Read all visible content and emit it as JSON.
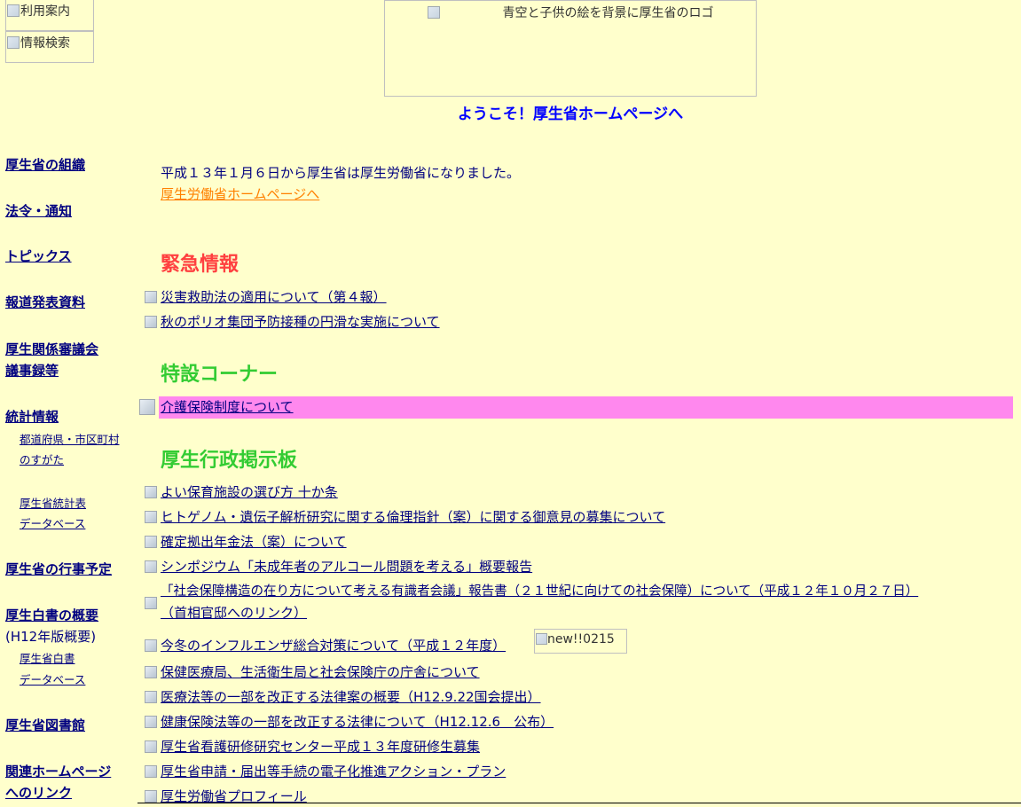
{
  "header": {
    "util_guide_alt": "利用案内",
    "info_search_alt": "情報検索",
    "logo_alt": "青空と子供の絵を背景に厚生省のロゴ",
    "welcome": "ようこそ！厚生省ホームページへ"
  },
  "sidebar": {
    "organization": "厚生省の組織",
    "laws": "法令・通知",
    "topics": "トピックス",
    "press": "報道発表資料",
    "council_line1": "厚生関係審議会",
    "council_line2": "議事録等",
    "statistics": "統計情報",
    "pref_line1": "都道府県・市区町村",
    "pref_line2": "のすがた",
    "stats_db_line1": "厚生省統計表",
    "stats_db_line2": "データベース",
    "schedule": "厚生省の行事予定",
    "whitepaper": "厚生白書の概要",
    "whitepaper_note": "(H12年版概要)",
    "wp_db_line1": "厚生省白書",
    "wp_db_line2": "データベース",
    "library": "厚生省図書館",
    "related_line1": "関連ホームページ",
    "related_line2": "へのリンク"
  },
  "notice": {
    "text": "平成１３年１月６日から厚生省は厚生労働省になりました。",
    "link": "厚生労働省ホームページへ"
  },
  "urgent": {
    "heading": "緊急情報",
    "items": [
      "災害救助法の適用について（第４報）",
      "秋のポリオ集団予防接種の円滑な実施について"
    ]
  },
  "special": {
    "heading": "特設コーナー",
    "item": "介護保険制度について"
  },
  "board": {
    "heading": "厚生行政掲示板",
    "items": [
      "よい保育施設の選び方 十か条",
      "ヒトゲノム・遺伝子解析研究に関する倫理指針（案）に関する御意見の募集について",
      "確定拠出年金法（案）について",
      "シンポジウム「未成年者のアルコール問題を考える」概要報告",
      "「社会保障構造の在り方について考える有識者会議」報告書（２１世紀に向けての社会保障）について（平成１２年１０月２７日）",
      "（首相官邸へのリンク）",
      "今冬のインフルエンザ総合対策について（平成１２年度）",
      "保健医療局、生活衛生局と社会保険庁の庁舎について",
      "医療法等の一部を改正する法律案の概要（H12.9.22国会提出）",
      "健康保険法等の一部を改正する法律について（H12.12.6　公布）",
      "厚生省看護研修研究センター平成１３年度研修生募集",
      "厚生省申請・届出等手続の電子化推進アクション・プラン",
      "厚生労働省プロフィール"
    ],
    "new_badge_alt": "new!!0215"
  }
}
